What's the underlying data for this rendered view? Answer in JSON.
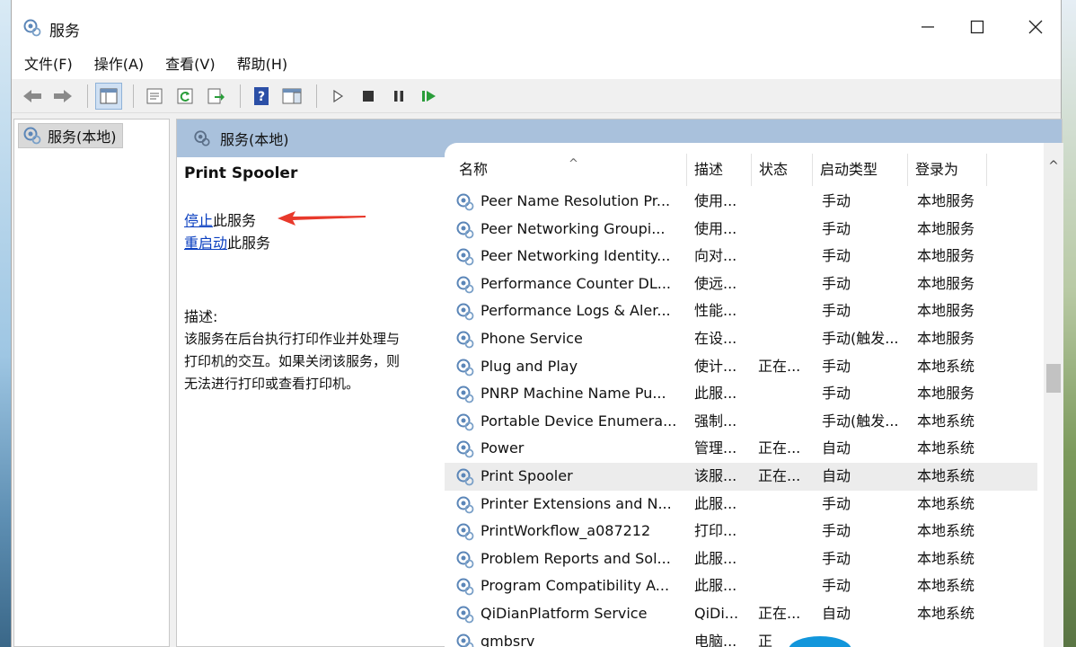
{
  "window": {
    "title": "服务",
    "controls": {
      "minimize": "—",
      "maximize": "☐",
      "close": "✕"
    }
  },
  "menubar": {
    "items": [
      "文件(F)",
      "操作(A)",
      "查看(V)",
      "帮助(H)"
    ]
  },
  "toolbar": {
    "icons": [
      "back-icon",
      "forward-icon",
      "show-hide-tree-icon",
      "properties-icon",
      "refresh-icon",
      "export-list-icon",
      "help-icon",
      "show-action-pane-icon",
      "start-service-icon",
      "stop-service-icon",
      "pause-service-icon",
      "restart-service-icon"
    ]
  },
  "tree": {
    "root_label": "服务(本地)"
  },
  "content": {
    "header_label": "服务(本地)",
    "selected_service": "Print Spooler",
    "stop_link": "停止",
    "stop_suffix": "此服务",
    "restart_link": "重启动",
    "restart_suffix": "此服务",
    "desc_label": "描述:",
    "description_lines": [
      "该服务在后台执行打印作业并处理与",
      "打印机的交互。如果关闭该服务，则",
      "无法进行打印或查看打印机。"
    ]
  },
  "columns": {
    "name": "名称",
    "desc": "描述",
    "status": "状态",
    "startup": "启动类型",
    "logon": "登录为",
    "sort_indicator": "^"
  },
  "services": [
    {
      "name": "Peer Name Resolution Pr...",
      "desc": "使用...",
      "status": "",
      "startup": "手动",
      "logon": "本地服务"
    },
    {
      "name": "Peer Networking Groupi...",
      "desc": "使用...",
      "status": "",
      "startup": "手动",
      "logon": "本地服务"
    },
    {
      "name": "Peer Networking Identity...",
      "desc": "向对...",
      "status": "",
      "startup": "手动",
      "logon": "本地服务"
    },
    {
      "name": "Performance Counter DL...",
      "desc": "使远...",
      "status": "",
      "startup": "手动",
      "logon": "本地服务"
    },
    {
      "name": "Performance Logs & Aler...",
      "desc": "性能...",
      "status": "",
      "startup": "手动",
      "logon": "本地服务"
    },
    {
      "name": "Phone Service",
      "desc": "在设...",
      "status": "",
      "startup": "手动(触发...",
      "logon": "本地服务"
    },
    {
      "name": "Plug and Play",
      "desc": "使计...",
      "status": "正在...",
      "startup": "手动",
      "logon": "本地系统"
    },
    {
      "name": "PNRP Machine Name Pu...",
      "desc": "此服...",
      "status": "",
      "startup": "手动",
      "logon": "本地服务"
    },
    {
      "name": "Portable Device Enumera...",
      "desc": "强制...",
      "status": "",
      "startup": "手动(触发...",
      "logon": "本地系统"
    },
    {
      "name": "Power",
      "desc": "管理...",
      "status": "正在...",
      "startup": "自动",
      "logon": "本地系统"
    },
    {
      "name": "Print Spooler",
      "desc": "该服...",
      "status": "正在...",
      "startup": "自动",
      "logon": "本地系统",
      "selected": true
    },
    {
      "name": "Printer Extensions and N...",
      "desc": "此服...",
      "status": "",
      "startup": "手动",
      "logon": "本地系统"
    },
    {
      "name": "PrintWorkflow_a087212",
      "desc": "打印...",
      "status": "",
      "startup": "手动",
      "logon": "本地系统"
    },
    {
      "name": "Problem Reports and Sol...",
      "desc": "此服...",
      "status": "",
      "startup": "手动",
      "logon": "本地系统"
    },
    {
      "name": "Program Compatibility A...",
      "desc": "此服...",
      "status": "",
      "startup": "手动",
      "logon": "本地系统"
    },
    {
      "name": "QiDianPlatform Service",
      "desc": "QiDi...",
      "status": "正在...",
      "startup": "自动",
      "logon": "本地系统"
    },
    {
      "name": "qmbsrv",
      "desc": "电脑...",
      "status": "正",
      "startup": "",
      "logon": ""
    }
  ],
  "colors": {
    "header_bg": "#a9c1dc",
    "link": "#0a3fc0",
    "annotation_arrow": "#e8392b",
    "selected_row": "#ececec"
  }
}
